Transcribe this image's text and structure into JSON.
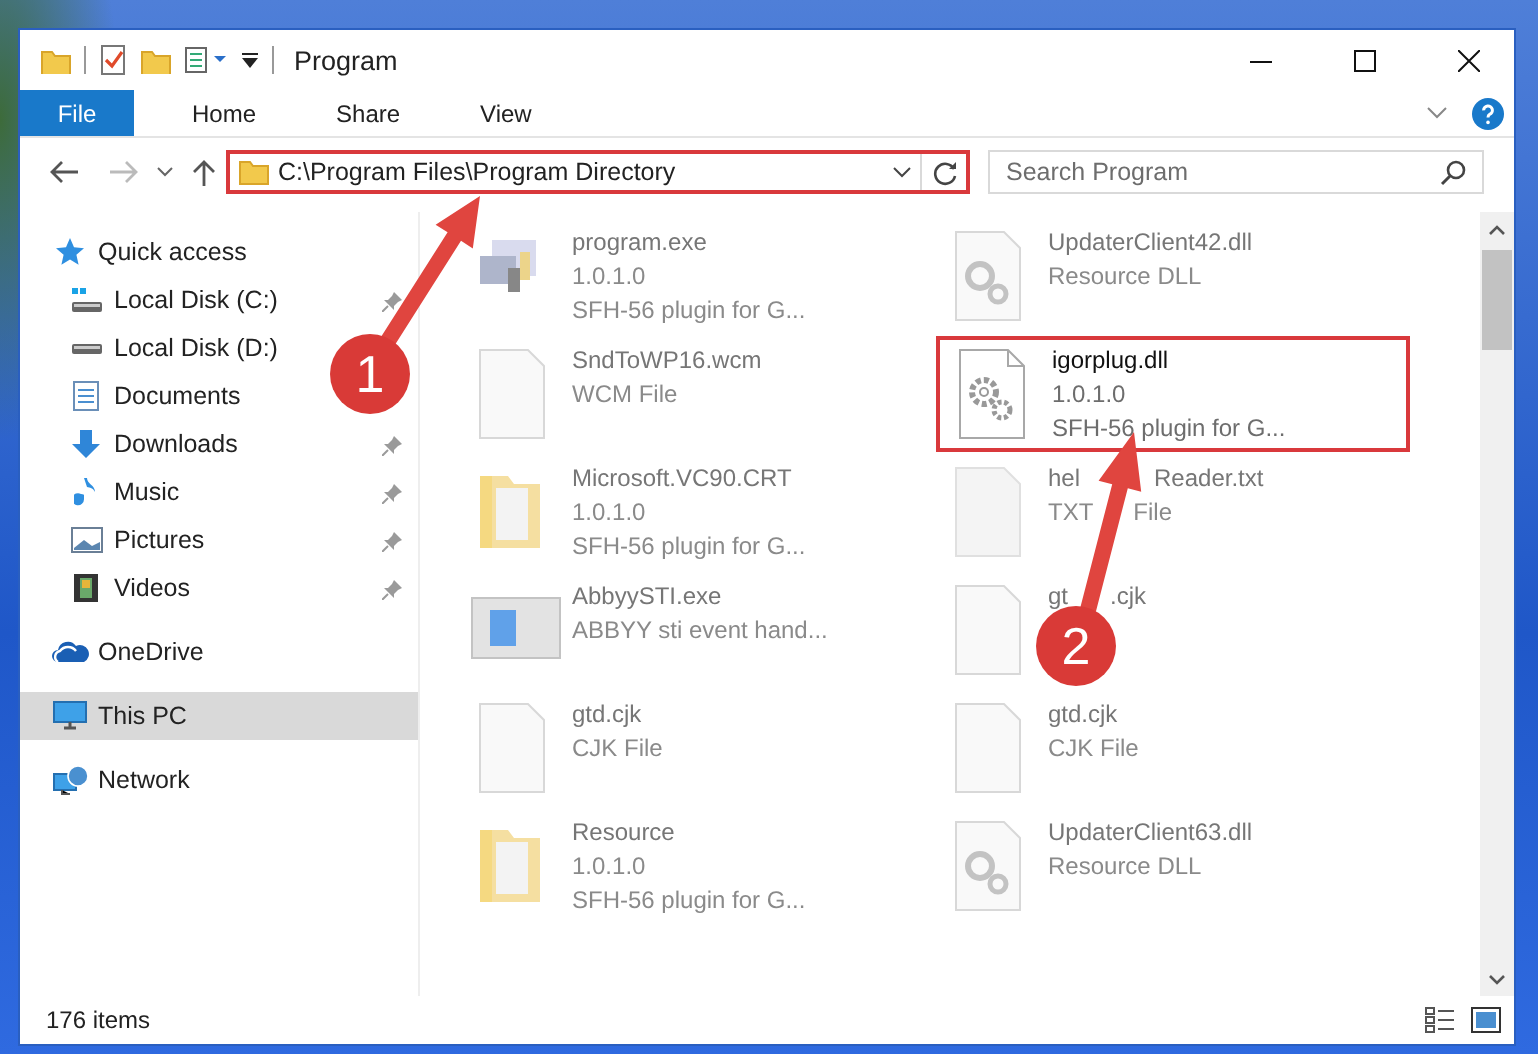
{
  "window": {
    "title": "Program"
  },
  "ribbon": {
    "tabs": [
      {
        "label": "File",
        "kind": "file",
        "selected": false
      },
      {
        "label": "Home",
        "kind": "tab",
        "selected": false
      },
      {
        "label": "Share",
        "kind": "tab",
        "selected": false
      },
      {
        "label": "View",
        "kind": "tab",
        "selected": false
      }
    ]
  },
  "address": {
    "path": "C:\\Program Files\\Program Directory",
    "highlighted": true
  },
  "search": {
    "placeholder": "Search Program"
  },
  "nav": {
    "items": [
      {
        "label": "Quick access",
        "selected": false,
        "children": [
          {
            "label": "Local Disk (C:)",
            "pinned": true,
            "selected": false
          },
          {
            "label": "Local Disk (D:)",
            "pinned": false,
            "selected": false
          },
          {
            "label": "Documents",
            "pinned": false,
            "selected": false
          },
          {
            "label": "Downloads",
            "pinned": true,
            "selected": false
          },
          {
            "label": "Music",
            "pinned": true,
            "selected": false
          },
          {
            "label": "Pictures",
            "pinned": true,
            "selected": false
          },
          {
            "label": "Videos",
            "pinned": true,
            "selected": false
          }
        ]
      },
      {
        "label": "OneDrive",
        "selected": false
      },
      {
        "label": "This PC",
        "selected": true
      },
      {
        "label": "Network",
        "selected": false
      }
    ]
  },
  "files": [
    {
      "name": "program.exe",
      "details": [
        "1.0.1.0",
        "SFH-56 plugin for G..."
      ],
      "blurred": true,
      "highlighted": false
    },
    {
      "name": "UpdaterClient42.dll",
      "details": [
        "Resource DLL"
      ],
      "blurred": true,
      "highlighted": false
    },
    {
      "name": "SndToWP16.wcm",
      "details": [
        "WCM File"
      ],
      "blurred": true,
      "highlighted": false
    },
    {
      "name": "igorplug.dll",
      "details": [
        "1.0.1.0",
        "SFH-56 plugin for G..."
      ],
      "blurred": false,
      "highlighted": true
    },
    {
      "name": "Microsoft.VC90.CRT",
      "details": [
        "1.0.1.0",
        "SFH-56 plugin for G..."
      ],
      "blurred": true,
      "highlighted": false
    },
    {
      "name": [
        "hel",
        "Reader.txt"
      ],
      "details": [
        [
          "TXT",
          "File"
        ]
      ],
      "blurred": true,
      "highlighted": false
    },
    {
      "name": "AbbyySTI.exe",
      "details": [
        "ABBYY sti event hand..."
      ],
      "blurred": true,
      "highlighted": false
    },
    {
      "name": [
        "gt",
        ".cjk"
      ],
      "blurred": true,
      "highlighted": false
    },
    {
      "name": "gtd.cjk",
      "details": [
        "CJK File"
      ],
      "blurred": true,
      "highlighted": false
    },
    {
      "name": "gtd.cjk",
      "details": [
        "CJK File"
      ],
      "blurred": true,
      "highlighted": false
    },
    {
      "name": "Resource",
      "details": [
        "1.0.1.0",
        "SFH-56 plugin for G..."
      ],
      "blurred": true,
      "highlighted": false
    },
    {
      "name": "UpdaterClient63.dll",
      "details": [
        "Resource DLL"
      ],
      "blurred": true,
      "highlighted": false
    }
  ],
  "annotations": [
    {
      "number": "1"
    },
    {
      "number": "2"
    }
  ],
  "status_bar": {
    "item_count": "176 items"
  }
}
